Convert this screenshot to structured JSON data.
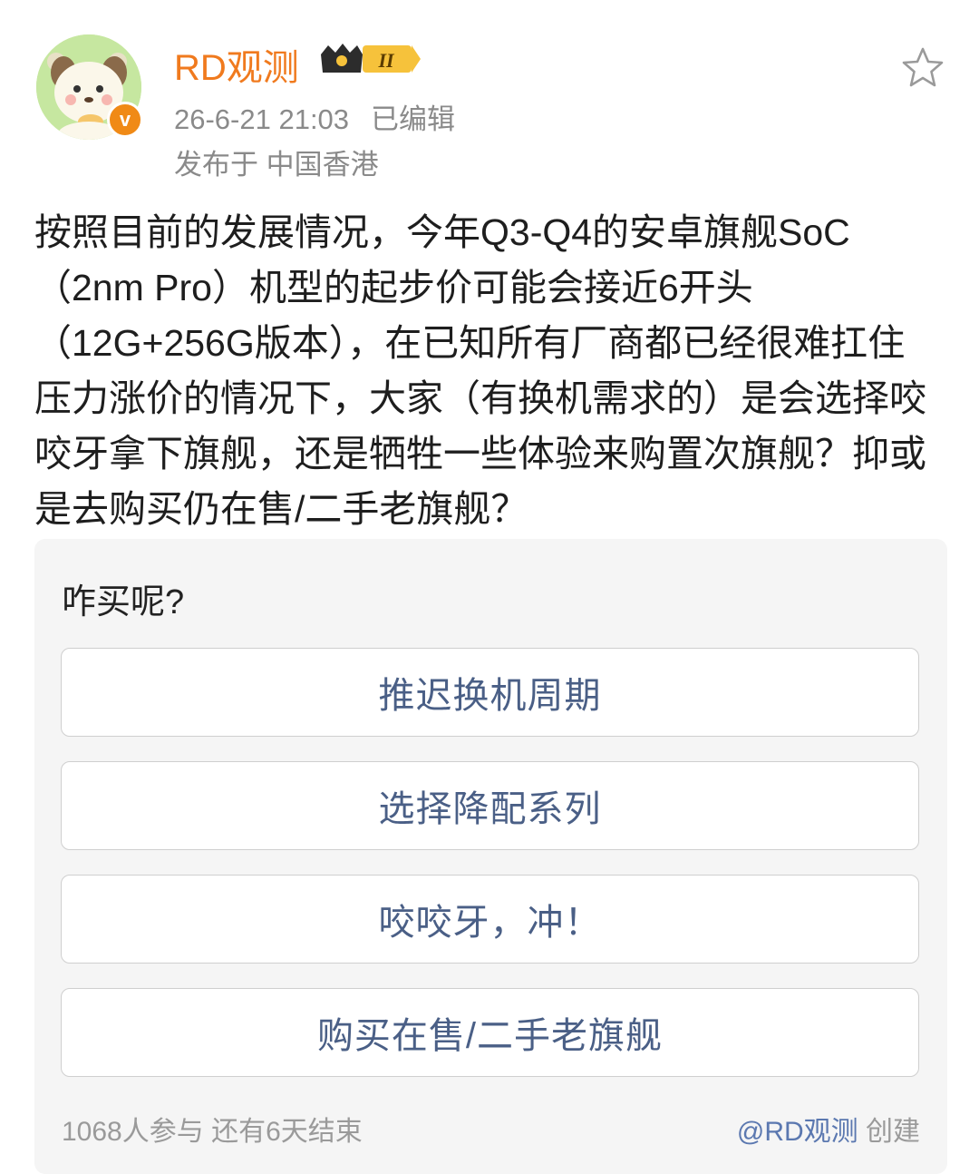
{
  "post": {
    "author": "RD观测",
    "level": "II",
    "time": "26-6-21 21:03",
    "edited": "已编辑",
    "location": "发布于 中国香港",
    "text": "按照目前的发展情况，今年Q3-Q4的安卓旗舰SoC（2nm Pro）机型的起步价可能会接近6开头（12G+256G版本），在已知所有厂商都已经很难扛住压力涨价的情况下，大家（有换机需求的）是会选择咬咬牙拿下旗舰，还是牺牲一些体验来购置次旗舰？抑或是去购买仍在售/二手老旗舰？"
  },
  "poll": {
    "question": "咋买呢?",
    "options": [
      {
        "label": "推迟换机周期"
      },
      {
        "label": "选择降配系列"
      },
      {
        "label": "咬咬牙，冲！"
      },
      {
        "label": "购买在售/二手老旗舰"
      }
    ],
    "stats": "1068人参与  还有6天结束",
    "creator_handle": "@RD观测",
    "creator_suffix": " 创建"
  },
  "colors": {
    "username": "#f07a1e",
    "option_text": "#4a5f86",
    "meta_text": "#8a8a8a",
    "verified_badge": "#f08a16"
  },
  "icons": [
    "verified-v-icon",
    "crown-level-icon",
    "star-favorite-icon"
  ]
}
